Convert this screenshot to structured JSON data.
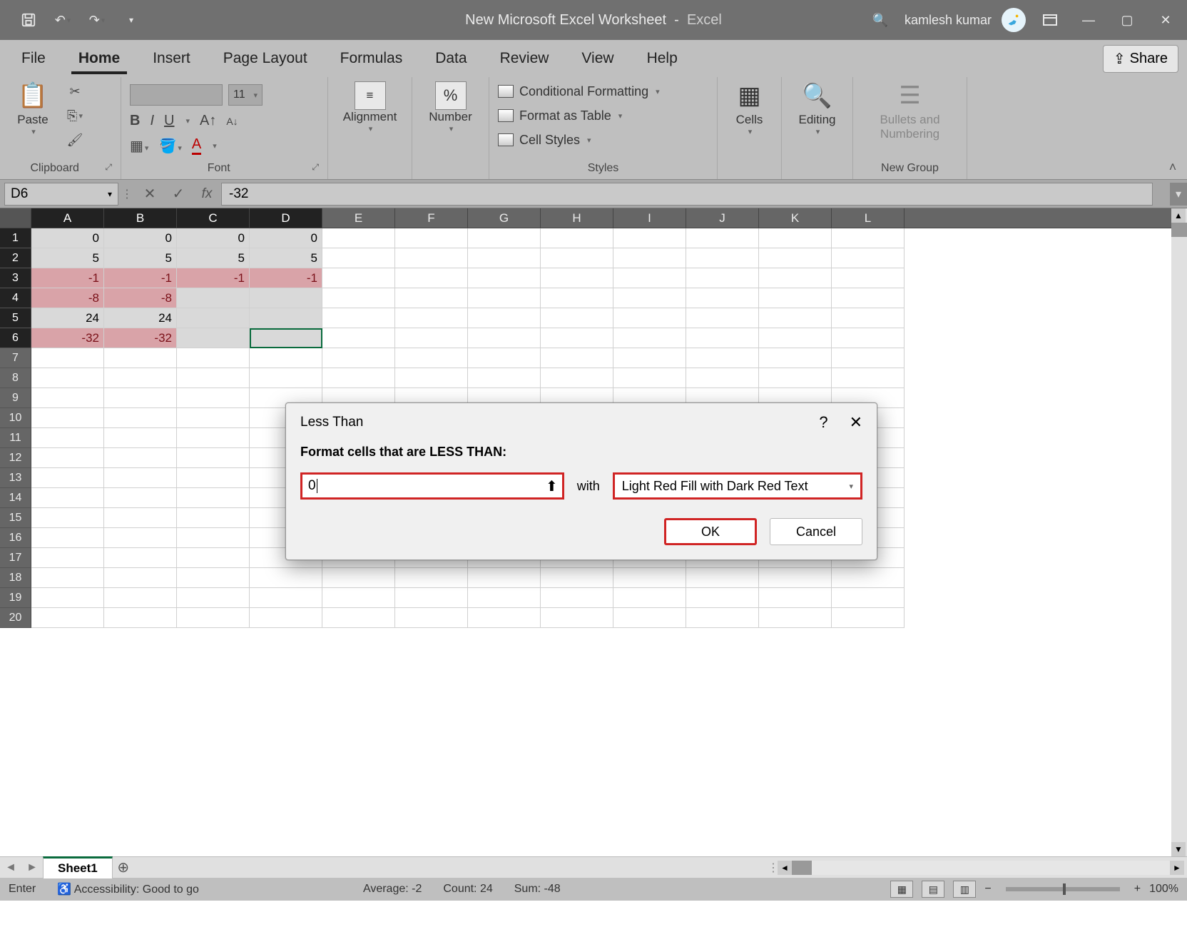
{
  "titlebar": {
    "doc_name": "New Microsoft Excel Worksheet",
    "app_name": "Excel",
    "user": "kamlesh kumar"
  },
  "tabs": {
    "file": "File",
    "home": "Home",
    "insert": "Insert",
    "page_layout": "Page Layout",
    "formulas": "Formulas",
    "data": "Data",
    "review": "Review",
    "view": "View",
    "help": "Help",
    "share": "Share"
  },
  "ribbon": {
    "clipboard": {
      "paste": "Paste",
      "label": "Clipboard"
    },
    "font": {
      "label": "Font",
      "size": "11",
      "bold": "B",
      "italic": "I",
      "underline": "U"
    },
    "alignment": {
      "btn": "Alignment"
    },
    "number": {
      "btn": "Number",
      "pct": "%"
    },
    "styles": {
      "cond": "Conditional Formatting",
      "table": "Format as Table",
      "cell": "Cell Styles",
      "label": "Styles"
    },
    "cells": {
      "btn": "Cells"
    },
    "editing": {
      "btn": "Editing"
    },
    "newgroup": {
      "btn": "Bullets and Numbering",
      "label": "New Group"
    }
  },
  "formula_bar": {
    "name_box": "D6",
    "formula": "-32"
  },
  "columns": [
    "A",
    "B",
    "C",
    "D",
    "E",
    "F",
    "G",
    "H",
    "I",
    "J",
    "K",
    "L"
  ],
  "row_count": 20,
  "data_rows": [
    {
      "r": 1,
      "cells": [
        "0",
        "0",
        "0",
        "0"
      ],
      "neg": false
    },
    {
      "r": 2,
      "cells": [
        "5",
        "5",
        "5",
        "5"
      ],
      "neg": false
    },
    {
      "r": 3,
      "cells": [
        "-1",
        "-1",
        "-1",
        "-1"
      ],
      "neg": true
    },
    {
      "r": 4,
      "cells": [
        "-8",
        "-8",
        "",
        ""
      ],
      "neg": true
    },
    {
      "r": 5,
      "cells": [
        "24",
        "24",
        "",
        ""
      ],
      "neg": false
    },
    {
      "r": 6,
      "cells": [
        "-32",
        "-32",
        "",
        ""
      ],
      "neg": true
    }
  ],
  "selection": {
    "from_row": 1,
    "to_row": 6,
    "from_col": 1,
    "to_col": 4,
    "active": "D6"
  },
  "sheet": {
    "name": "Sheet1"
  },
  "status": {
    "mode": "Enter",
    "accessibility": "Accessibility: Good to go",
    "average": "Average: -2",
    "count": "Count: 24",
    "sum": "Sum: -48",
    "zoom": "100%"
  },
  "dialog": {
    "title": "Less Than",
    "prompt": "Format cells that are LESS THAN:",
    "value": "0",
    "with": "with",
    "format_option": "Light Red Fill with Dark Red Text",
    "ok": "OK",
    "cancel": "Cancel"
  }
}
